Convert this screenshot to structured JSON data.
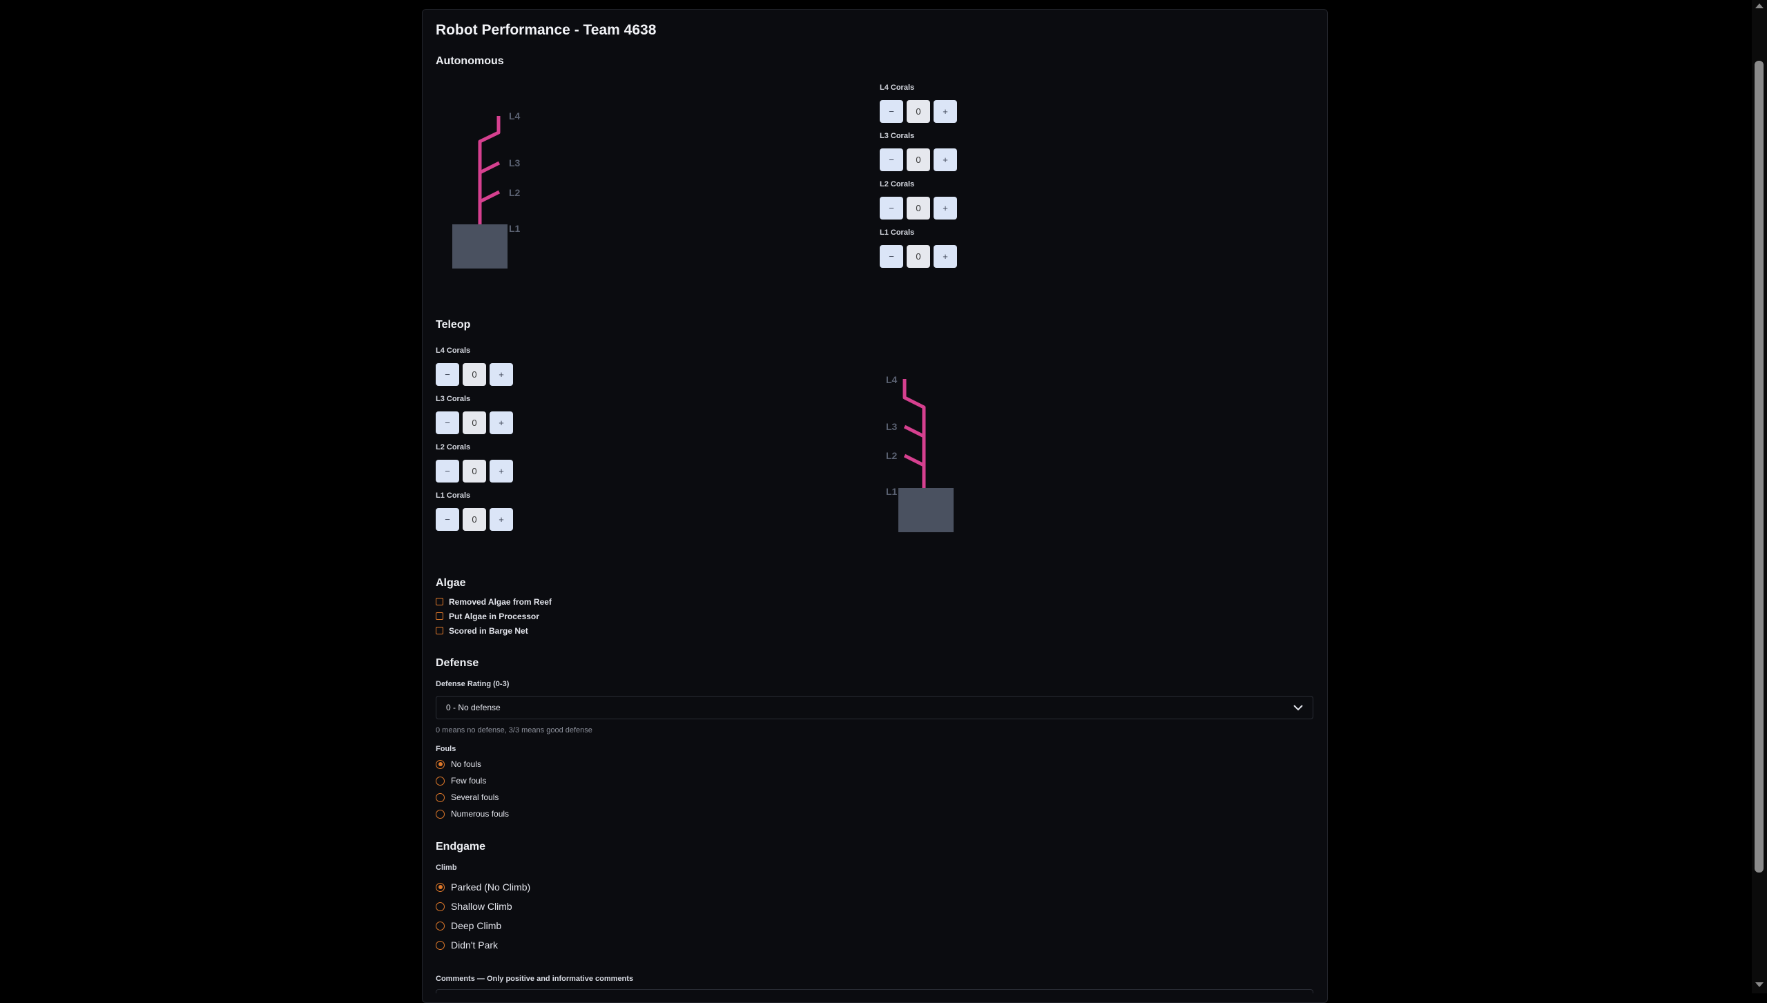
{
  "title": "Robot Performance - Team 4638",
  "autonomous": {
    "heading": "Autonomous",
    "counters": [
      {
        "label": "L4 Corals",
        "value": "0"
      },
      {
        "label": "L3 Corals",
        "value": "0"
      },
      {
        "label": "L2 Corals",
        "value": "0"
      },
      {
        "label": "L1 Corals",
        "value": "0"
      }
    ]
  },
  "teleop": {
    "heading": "Teleop",
    "counters": [
      {
        "label": "L4 Corals",
        "value": "0"
      },
      {
        "label": "L3 Corals",
        "value": "0"
      },
      {
        "label": "L2 Corals",
        "value": "0"
      },
      {
        "label": "L1 Corals",
        "value": "0"
      }
    ]
  },
  "counter_buttons": {
    "minus": "−",
    "plus": "+"
  },
  "reef_levels": {
    "l4": "L4",
    "l3": "L3",
    "l2": "L2",
    "l1": "L1"
  },
  "algae": {
    "heading": "Algae",
    "options": [
      "Removed Algae from Reef",
      "Put Algae in Processor",
      "Scored in Barge Net"
    ]
  },
  "defense": {
    "heading": "Defense",
    "rating_label": "Defense Rating (0-3)",
    "rating_selected": "0 - No defense",
    "rating_hint": "0 means no defense, 3/3 means good defense",
    "fouls_label": "Fouls",
    "fouls_options": [
      "No fouls",
      "Few fouls",
      "Several fouls",
      "Numerous fouls"
    ],
    "fouls_selected": 0
  },
  "endgame": {
    "heading": "Endgame",
    "climb_label": "Climb",
    "climb_options": [
      "Parked (No Climb)",
      "Shallow Climb",
      "Deep Climb",
      "Didn't Park"
    ],
    "climb_selected": 0
  },
  "comments_label": "Comments — Only positive and informative comments",
  "colors": {
    "coral": "#d6408f",
    "accent": "#e0792a",
    "base": "#4a5160"
  }
}
